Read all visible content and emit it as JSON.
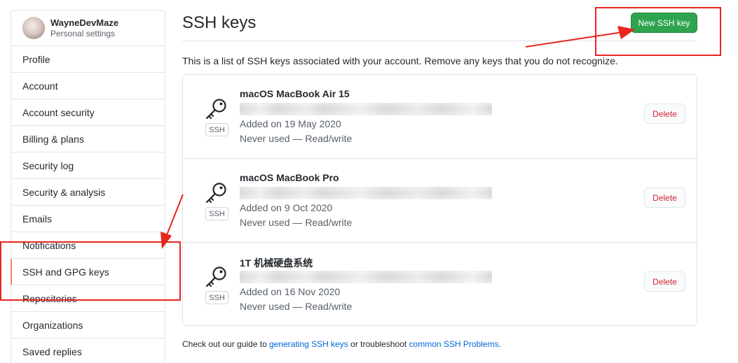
{
  "user": {
    "username": "WayneDevMaze",
    "subtitle": "Personal settings"
  },
  "sidebar": {
    "items": [
      {
        "label": "Profile"
      },
      {
        "label": "Account"
      },
      {
        "label": "Account security"
      },
      {
        "label": "Billing & plans"
      },
      {
        "label": "Security log"
      },
      {
        "label": "Security & analysis"
      },
      {
        "label": "Emails"
      },
      {
        "label": "Notifications"
      },
      {
        "label": "SSH and GPG keys"
      },
      {
        "label": "Repositories"
      },
      {
        "label": "Organizations"
      },
      {
        "label": "Saved replies"
      }
    ],
    "selected": "SSH and GPG keys"
  },
  "main": {
    "title": "SSH keys",
    "new_key_button": "New SSH key",
    "description": "This is a list of SSH keys associated with your account. Remove any keys that you do not recognize.",
    "keys": [
      {
        "title": "macOS MacBook Air 15",
        "badge": "SSH",
        "added": "Added on 19 May 2020",
        "usage": "Never used — Read/write",
        "delete": "Delete"
      },
      {
        "title": "macOS MacBook Pro",
        "badge": "SSH",
        "added": "Added on 9 Oct 2020",
        "usage": "Never used — Read/write",
        "delete": "Delete"
      },
      {
        "title": "1T 机械硬盘系统",
        "badge": "SSH",
        "added": "Added on 16 Nov 2020",
        "usage": "Never used — Read/write",
        "delete": "Delete"
      }
    ],
    "footer": {
      "prefix": "Check out our guide to ",
      "link1": "generating SSH keys",
      "middle": " or troubleshoot ",
      "link2": "common SSH Problems",
      "suffix": "."
    }
  },
  "colors": {
    "primary_button": "#2ea44f",
    "danger_text": "#cb2431",
    "link": "#0366d6",
    "annotation": "#e8251f",
    "selected_indicator": "#f9826c"
  },
  "icons": {
    "key": "key-icon"
  }
}
